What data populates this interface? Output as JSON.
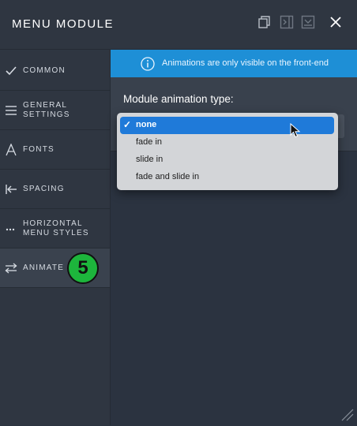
{
  "header": {
    "title": "MENU MODULE"
  },
  "sidebar": {
    "items": [
      {
        "label": "COMMON",
        "icon": "check-icon"
      },
      {
        "label": "GENERAL SETTINGS",
        "icon": "menu-lines-icon"
      },
      {
        "label": "FONTS",
        "icon": "font-a-icon"
      },
      {
        "label": "SPACING",
        "icon": "arrow-left-bar-icon"
      },
      {
        "label": "HORIZONTAL MENU STYLES",
        "icon": "ellipsis-icon"
      },
      {
        "label": "ANIMATE",
        "icon": "swap-arrows-icon"
      }
    ],
    "step_badge": "5"
  },
  "main": {
    "notice": "Animations are only visible on the front-end",
    "field_label": "Module animation type:",
    "dropdown": {
      "selected": "none",
      "options": [
        "none",
        "fade in",
        "slide in",
        "fade and slide in"
      ]
    }
  },
  "colors": {
    "accent_blue": "#1e8fd6",
    "selection_blue": "#1f7ad9",
    "badge_green": "#1db53c"
  }
}
